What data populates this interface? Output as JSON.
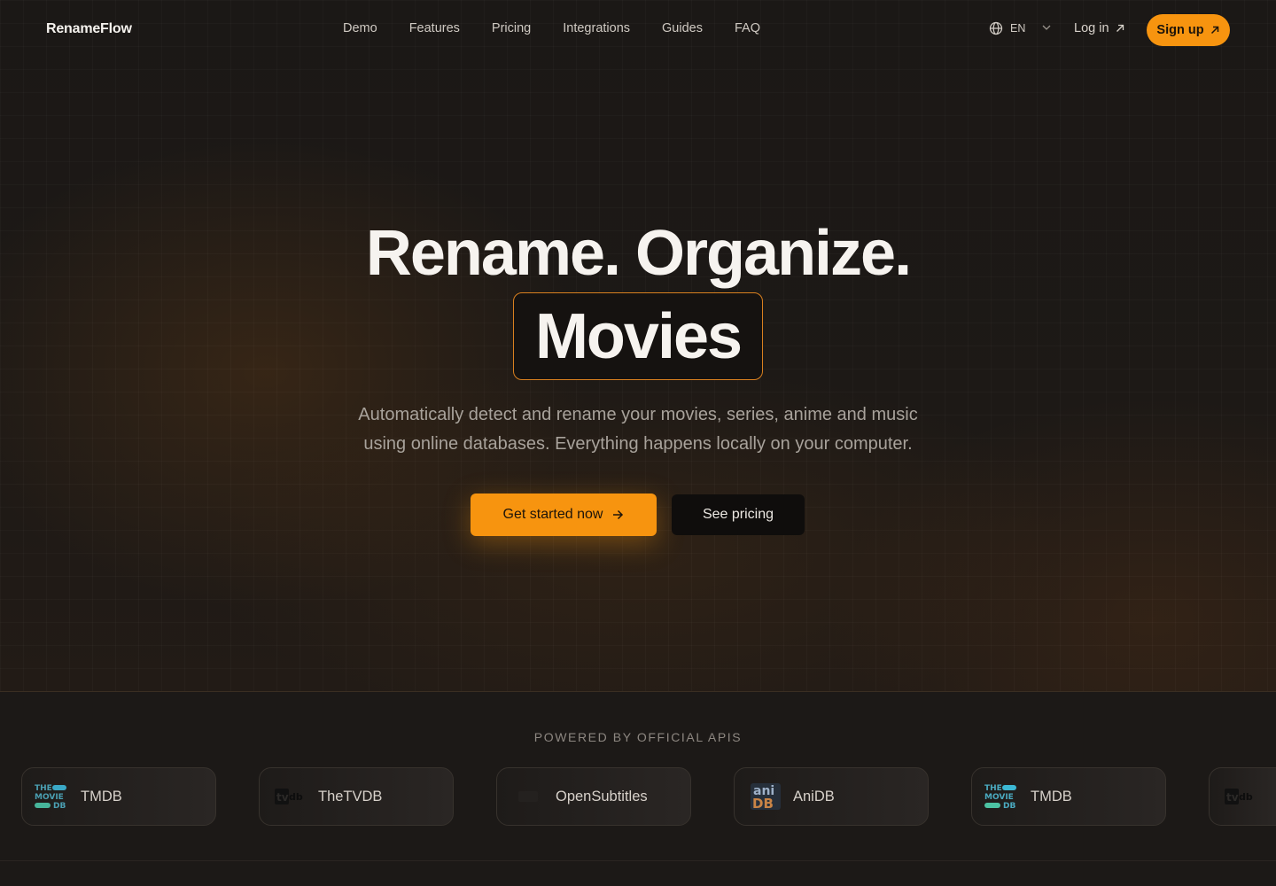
{
  "nav": {
    "logo": "RenameFlow",
    "links": [
      "Demo",
      "Features",
      "Pricing",
      "Integrations",
      "Guides",
      "FAQ"
    ],
    "language": "EN",
    "login": "Log in",
    "signup": "Sign up"
  },
  "hero": {
    "headline": "Rename. Organize.",
    "highlight": "Movies",
    "subtitle_line1": "Automatically detect and rename your movies, series, anime and music",
    "subtitle_line2": "using online databases. Everything happens locally on your computer.",
    "cta_primary": "Get started now",
    "cta_secondary": "See pricing"
  },
  "apis": {
    "title": "POWERED BY OFFICIAL APIS",
    "cards": [
      {
        "name": "TMDB",
        "logo": "tmdb-logo"
      },
      {
        "name": "TheTVDB",
        "logo": "tvdb-logo"
      },
      {
        "name": "OpenSubtitles",
        "logo": "opensubtitles-logo"
      },
      {
        "name": "AniDB",
        "logo": "anidb-logo"
      },
      {
        "name": "TMDB",
        "logo": "tmdb-logo"
      },
      {
        "name": "",
        "logo": "tvdb-logo"
      }
    ]
  },
  "colors": {
    "accent": "#f7940f",
    "background": "#1a1715",
    "box_border": "#d9801f"
  }
}
